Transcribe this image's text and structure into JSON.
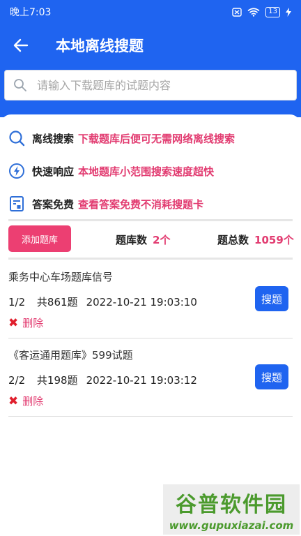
{
  "status_bar": {
    "time": "晚上7:03",
    "battery": "13"
  },
  "header": {
    "title": "本地离线搜题"
  },
  "search": {
    "placeholder": "请输入下载题库的试题内容"
  },
  "features": [
    {
      "icon": "search-icon",
      "name": "离线搜索",
      "desc": "下载题库后便可无需网络离线搜索"
    },
    {
      "icon": "lightning-icon",
      "name": "快速响应",
      "desc": "本地题库小范围搜索速度超快"
    },
    {
      "icon": "answer-sheet-icon",
      "name": "答案免费",
      "desc": "查看答案免费不消耗搜题卡"
    }
  ],
  "stats": {
    "add_label": "添加题库",
    "bank_count_label": "题库数",
    "bank_count": "2个",
    "question_total_label": "题总数",
    "question_total": "1059个"
  },
  "banks": [
    {
      "title": "乘务中心车场题库信号",
      "progress": "1/2",
      "count": "共861题",
      "timestamp": "2022-10-21 19:03:10",
      "search_label": "搜题",
      "delete_label": "删除"
    },
    {
      "title": "《客运通用题库》599试题",
      "progress": "2/2",
      "count": "共198题",
      "timestamp": "2022-10-21 19:03:12",
      "search_label": "搜题",
      "delete_label": "删除"
    }
  ],
  "watermark": {
    "main": "谷普软件园",
    "sub": "www.gupuxiazai.com"
  },
  "colors": {
    "primary": "#1f64f0",
    "accent": "#e23c71",
    "add_button": "#ec3f72",
    "delete_icon": "#e01f2d"
  }
}
